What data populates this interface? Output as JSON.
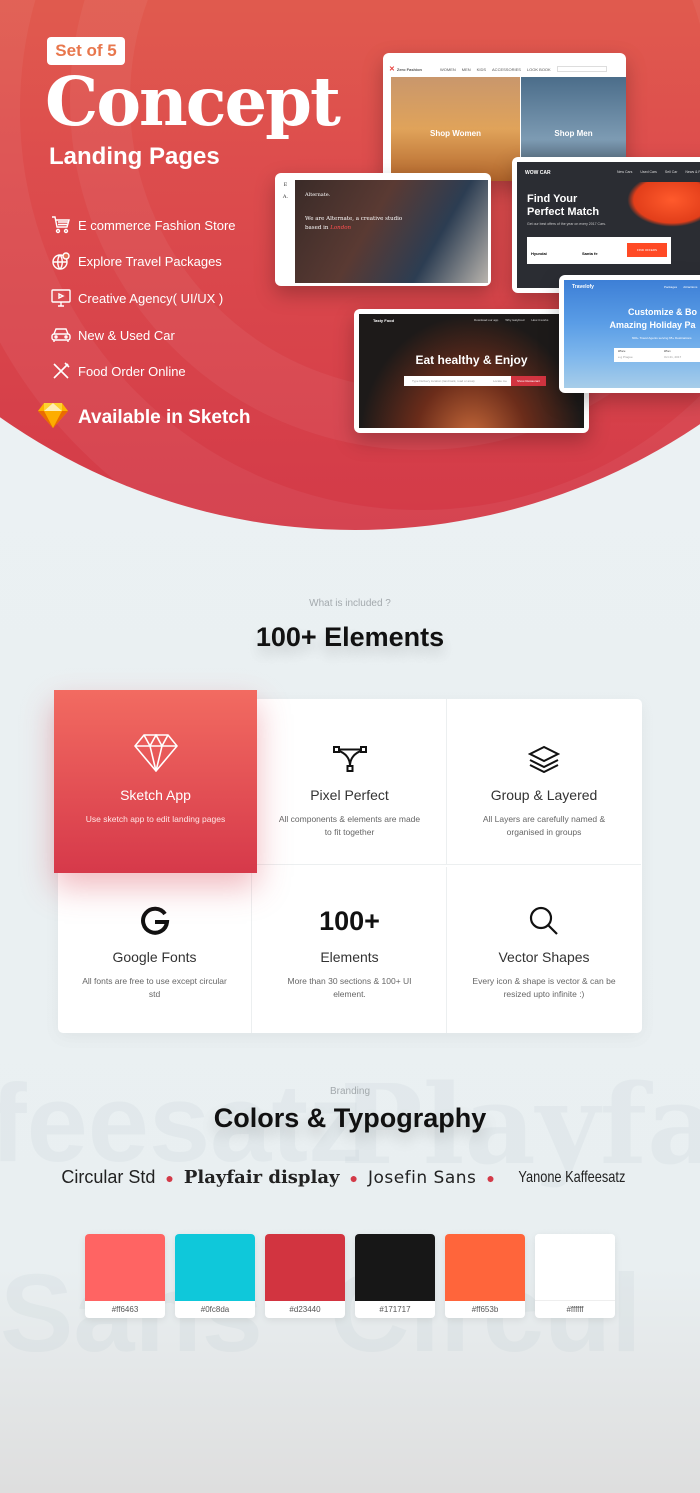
{
  "hero": {
    "badge": "Set of 5",
    "title": "Concept",
    "subtitle": "Landing Pages",
    "features": [
      {
        "icon": "cart-icon",
        "label": "E commerce Fashion Store"
      },
      {
        "icon": "globe-pin-icon",
        "label": "Explore Travel Packages"
      },
      {
        "icon": "monitor-icon",
        "label": "Creative Agency( UI/UX )"
      },
      {
        "icon": "car-icon",
        "label": "New & Used Car"
      },
      {
        "icon": "fork-knife-icon",
        "label": "Food Order Online"
      }
    ],
    "sketch_label": "Available in Sketch"
  },
  "previews": {
    "fashion": {
      "brand": "Zero Fashion",
      "nav": [
        "WOMEN",
        "MEN",
        "KIDS",
        "ACCESSORIES",
        "LOOK BOOK"
      ],
      "left": "Shop Women",
      "right": "Shop Men"
    },
    "agency": {
      "brand": "Alternate.",
      "line1": "We are Alternate, a creative studio",
      "line2": "based in",
      "city": "London"
    },
    "car": {
      "brand": "WOW CAR",
      "nav": [
        "New Cars",
        "Used Cars",
        "Sell Car",
        "News & Re"
      ],
      "h1": "Find Your",
      "h2": "Perfect Match",
      "sub": "Get our best offers of the year on every 2017 Cars.",
      "tabs": [
        "New Car",
        "Used Car"
      ],
      "make": "Hyundai",
      "model": "Santa fe",
      "cta": "FIND OFFERS"
    },
    "food": {
      "brand": "Tasty Food",
      "nav": [
        "Download our app",
        "Why tastyfood",
        "How it works",
        "Sign"
      ],
      "headline": "Eat healthy & Enjoy",
      "placeholder": "Type Delivery location (landmark, road or area)",
      "locate": "Locate me",
      "cta": "Show Restaurant"
    },
    "travel": {
      "brand": "Travelofy",
      "nav": [
        "Packages",
        "Attractions"
      ],
      "h1": "Customize & Bo",
      "h2": "Amazing Holiday Pa",
      "sub": "600+ Travel Agents serving 65+ Destinations",
      "where_label": "Where",
      "where": "e.g Prague",
      "when_label": "When",
      "when": "Oct 21, 2017"
    }
  },
  "elements": {
    "label": "What is included ?",
    "title": "100+ Elements",
    "cards": [
      {
        "icon": "diamond-icon",
        "title": "Sketch App",
        "desc": "Use sketch app to edit landing pages"
      },
      {
        "icon": "bezier-icon",
        "title": "Pixel Perfect",
        "desc": "All components & elements are made to fit together"
      },
      {
        "icon": "layers-icon",
        "title": "Group & Layered",
        "desc": "All Layers are carefully named & organised in groups"
      },
      {
        "icon": "google-icon",
        "title": "Google Fonts",
        "desc": "All fonts are free to use except circular std"
      },
      {
        "big": "100+",
        "title": "Elements",
        "desc": "More than 30 sections & 100+ UI element."
      },
      {
        "icon": "search-icon",
        "title": "Vector Shapes",
        "desc": "Every icon & shape is vector &  can be resized upto infinite :)"
      }
    ]
  },
  "branding": {
    "label": "Branding",
    "title": "Colors & Typography",
    "fonts": [
      "Circular Std",
      "Playfair display",
      "Josefin Sans",
      "Yanone Kaffeesatz"
    ],
    "ghost_top": [
      "feesatz",
      "Playfair d"
    ],
    "ghost_bottom": [
      "Sans",
      "Circul"
    ],
    "swatches": [
      "#ff6463",
      "#0fc8da",
      "#d23440",
      "#171717",
      "#ff653b",
      "#ffffff"
    ]
  }
}
